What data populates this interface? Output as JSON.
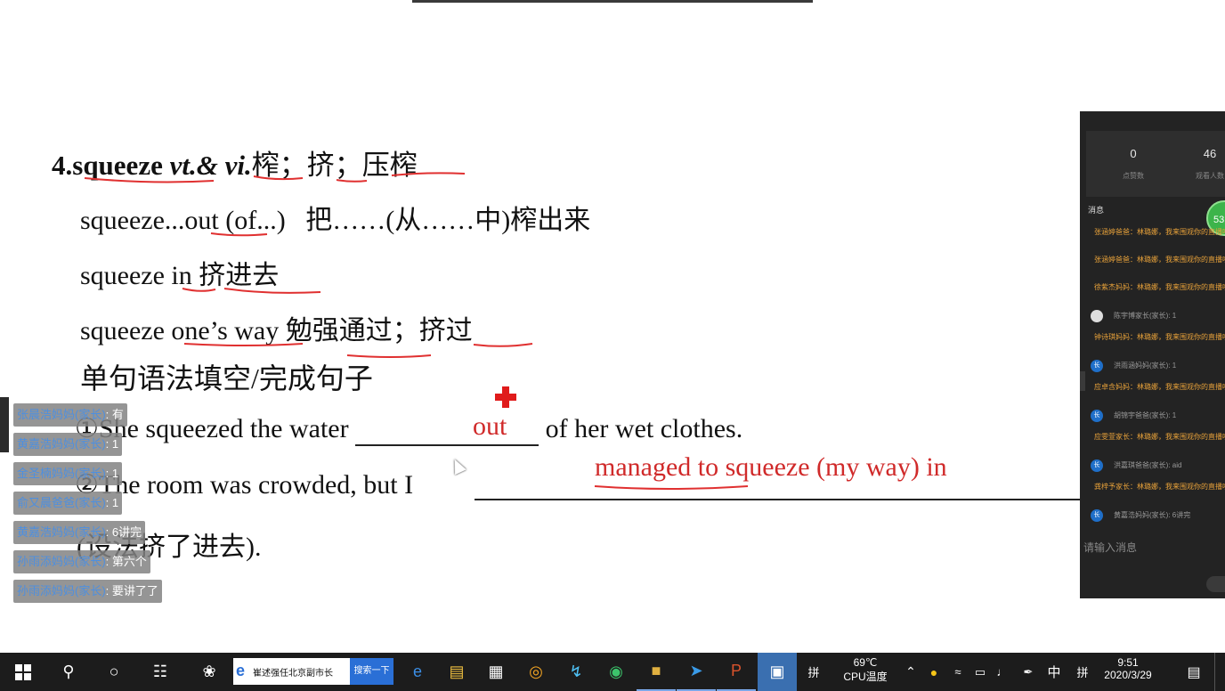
{
  "slide": {
    "heading": {
      "num": "4.",
      "word": "squeeze ",
      "pos": "vt.& vi.",
      "meaning": "榨；挤；压榨"
    },
    "phrase1": "squeeze...out (of...)   把……(从……中)榨出来",
    "phrase2": "squeeze in  挤进去",
    "phrase3": "squeeze one’s way  勉强通过；挤过",
    "section": "单句语法填空/完成句子",
    "s1_pre": "①She squeezed the water ",
    "s1_post": " of her wet clothes.",
    "s1_answer": "out",
    "s2_pre": "②The room was crowded, but I ",
    "s2_answer": "managed to squeeze (my way) in",
    "s3": "(设法挤了进去)."
  },
  "chat": {
    "likes_count": "0",
    "likes_label": "点赞数",
    "viewers_count": "46",
    "viewers_label": "观看人数",
    "messages_title": "消息",
    "badge": "53",
    "messages": [
      {
        "type": "sys",
        "text": "张涵婷爸爸：林璐娜，我来围观你的直播啦，为你点赞!"
      },
      {
        "type": "sys",
        "text": "张涵婷爸爸：林璐娜，我来围观你的直播啦，为你点赞!"
      },
      {
        "type": "sys",
        "text": "徐紫杰妈妈：林璐娜，我来围观你的直播啦，为你点赞!"
      },
      {
        "type": "user",
        "avatar": "",
        "text": "陈宇博家长(家长): 1"
      },
      {
        "type": "sys",
        "text": "钟诗琪妈妈：林璐娜，我来围观你的直播啦，为你点赞!"
      },
      {
        "type": "user",
        "avatar": "长",
        "text": "洪雨涵妈妈(家长): 1"
      },
      {
        "type": "sys",
        "text": "应卓含妈妈：林璐娜，我来围观你的直播啦，为你点赞!"
      },
      {
        "type": "user",
        "avatar": "长",
        "text": "胡锦宇爸爸(家长): 1"
      },
      {
        "type": "sys",
        "text": "应雯萱家长：林璐娜，我来围观你的直播啦，为你点赞!"
      },
      {
        "type": "user",
        "avatar": "长",
        "text": "洪嘉琪爸爸(家长): aid"
      },
      {
        "type": "sys",
        "text": "龚梓予家长：林璐娜，我来围观你的直播啦，为你点赞!"
      },
      {
        "type": "user",
        "avatar": "长",
        "text": "黄嘉浩妈妈(家长): 6讲完"
      }
    ],
    "input_placeholder": "请输入消息"
  },
  "danmaku": [
    {
      "name": "张晨浩妈妈(家长)",
      "text": ": 有"
    },
    {
      "name": "黄嘉浩妈妈(家长)",
      "text": ": 1"
    },
    {
      "name": "金圣楠妈妈(家长)",
      "text": ": 1"
    },
    {
      "name": "俞又晨爸爸(家长)",
      "text": ": 1"
    },
    {
      "name": "黄嘉浩妈妈(家长)",
      "text": ": 6讲完"
    },
    {
      "name": "孙雨添妈妈(家长)",
      "text": ": 第六个"
    },
    {
      "name": "孙雨添妈妈(家长)",
      "text": ": 要讲了了"
    }
  ],
  "taskbar": {
    "search_text": "崔述强任北京副市长",
    "search_button": "搜索一下",
    "temp": "69℃",
    "temp_label": "CPU温度",
    "ime": "中",
    "time": "9:51",
    "date": "2020/3/29"
  },
  "colors": {
    "answer": "#d02a2a",
    "underline": "#e03030",
    "taskbar": "#1c1c1c",
    "panel": "#232323"
  }
}
